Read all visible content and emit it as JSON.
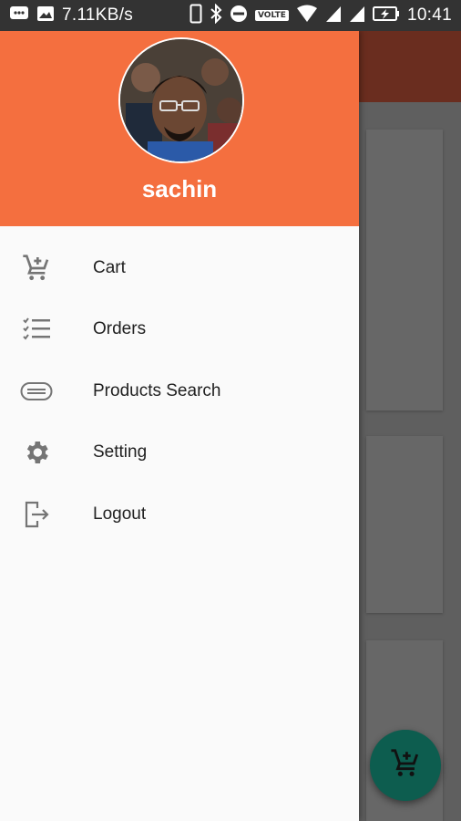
{
  "status_bar": {
    "network_speed": "7.11KB/s",
    "volte": "VOLTE",
    "time": "10:41",
    "icons": [
      "message-icon",
      "image-icon",
      "phone-icon",
      "bluetooth-icon",
      "do-not-disturb-icon",
      "wifi-icon",
      "signal-icon",
      "signal-icon",
      "battery-charging-icon"
    ]
  },
  "drawer": {
    "header_color": "#f46f3f",
    "username": "sachin",
    "items": [
      {
        "label": "Cart",
        "icon": "cart-add-icon"
      },
      {
        "label": "Orders",
        "icon": "checklist-icon"
      },
      {
        "label": "Products Search",
        "icon": "barcode-scan-icon"
      },
      {
        "label": "Setting",
        "icon": "gear-icon"
      },
      {
        "label": "Logout",
        "icon": "logout-icon"
      }
    ]
  },
  "background_app": {
    "appbar_color": "#6a2d1f",
    "fab_color": "#0d5d4f",
    "fab_icon": "cart-add-icon"
  }
}
